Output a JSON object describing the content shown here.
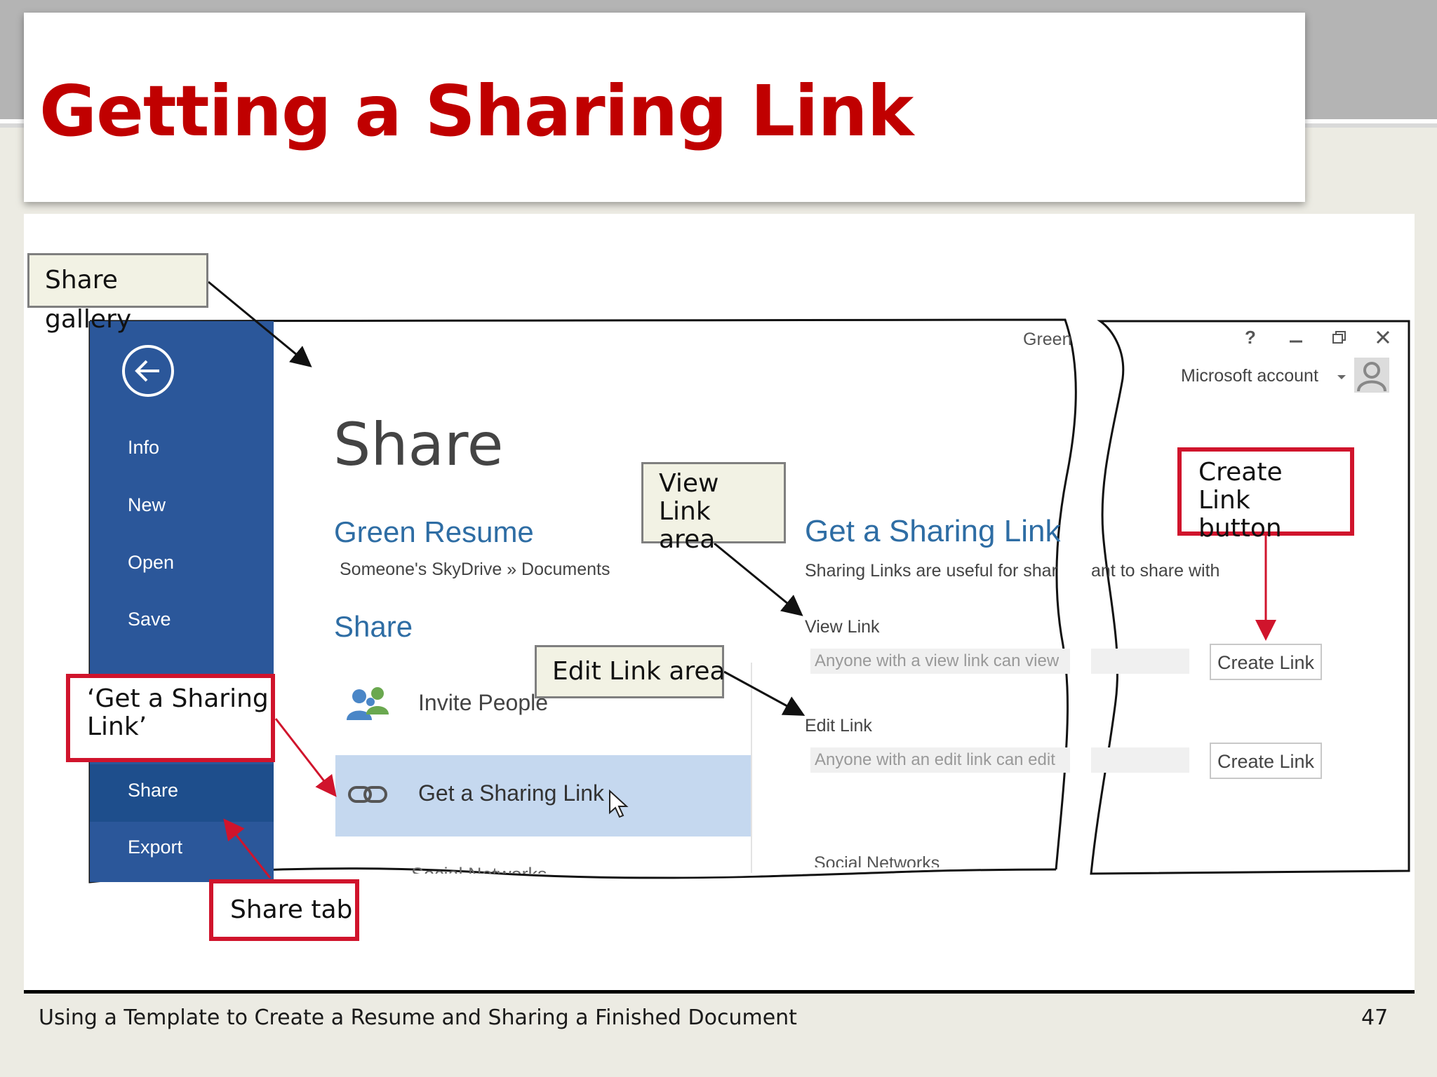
{
  "slide": {
    "title": "Getting a Sharing Link",
    "footer": "Using a Template to Create a Resume and Sharing a Finished Document",
    "page_number": "47"
  },
  "sidebar": {
    "items": [
      {
        "label": "Info"
      },
      {
        "label": "New"
      },
      {
        "label": "Open"
      },
      {
        "label": "Save"
      },
      {
        "label": "Share"
      },
      {
        "label": "Export"
      }
    ]
  },
  "backstage": {
    "heading": "Share",
    "doc_title": "Green Resume",
    "doc_path": "Someone's SkyDrive » Documents",
    "share_subheading": "Share",
    "title_fragment": "Green",
    "options": [
      {
        "label": "Invite People",
        "icon": "people-icon"
      },
      {
        "label": "Get a Sharing Link",
        "icon": "link-icon"
      }
    ],
    "partial_option": "Social Networks",
    "account": "Microsoft account",
    "help_glyph": "?"
  },
  "sharing_panel": {
    "title": "Get a Sharing Link",
    "description_left": "Sharing Links are useful for shar",
    "description_right": "ant to share with",
    "view_link_label": "View Link",
    "view_link_text": "Anyone with a view link can view",
    "edit_link_label": "Edit Link",
    "edit_link_text": "Anyone with an edit link can edit",
    "create_view_button": "Create Link",
    "create_edit_button": "Create Link",
    "social_label": "Social Networks"
  },
  "callouts": {
    "share_gallery": "Share gallery",
    "view_link_area_1": "View Link",
    "view_link_area_2": "area",
    "edit_link_area": "Edit Link area",
    "create_link_button_1": "Create Link",
    "create_link_button_2": "button",
    "get_sharing_link_1": "‘Get a Sharing",
    "get_sharing_link_2": "Link’",
    "share_tab": "Share tab"
  },
  "colors": {
    "title_red": "#c00000",
    "word_blue": "#2b579a",
    "callout_red": "#d0142c",
    "selected_row": "#c5d8ef",
    "link_blue": "#2e6da4"
  }
}
